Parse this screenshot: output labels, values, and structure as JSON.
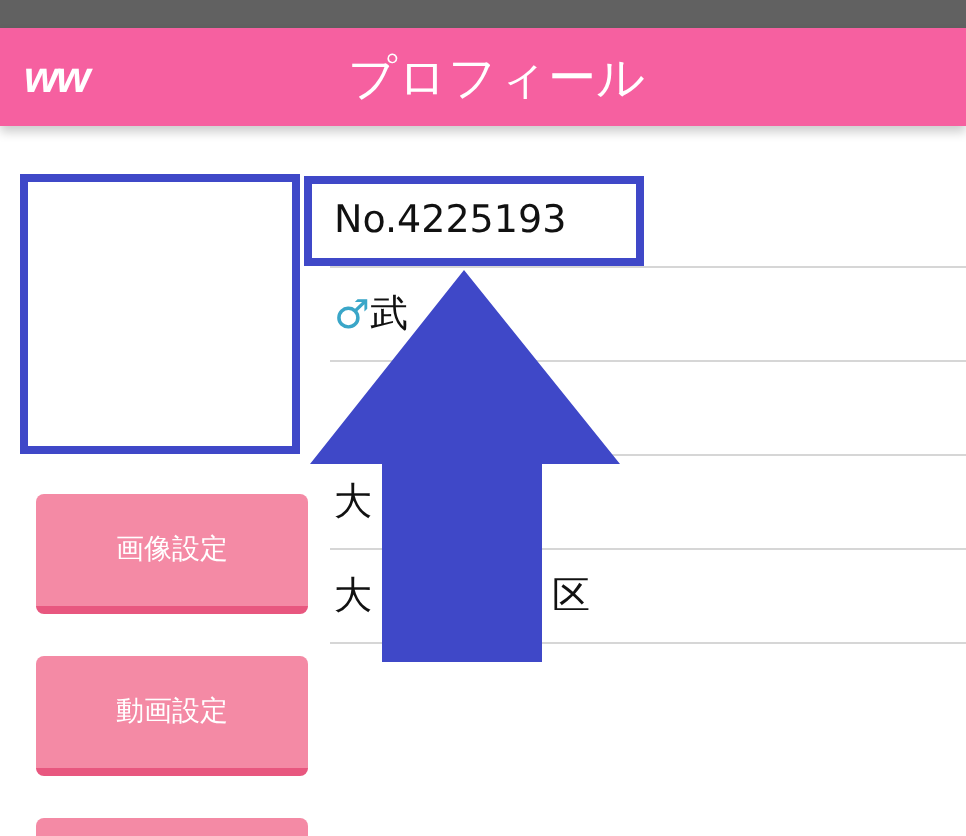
{
  "header": {
    "logo": "ww",
    "title": "プロフィール"
  },
  "avatar": {
    "highlighted": true
  },
  "buttons": [
    {
      "kind": "labeled",
      "label": "画像設定"
    },
    {
      "kind": "labeled",
      "label": "動画設定"
    },
    {
      "kind": "blank"
    }
  ],
  "rows": [
    {
      "texts": [
        "No.4225193"
      ],
      "highlighted": true
    },
    {
      "symbol": "♂",
      "texts": [
        "武"
      ],
      "highlighted": false
    },
    {
      "highlighted": false
    },
    {
      "texts": [
        "大"
      ],
      "highlighted": false
    },
    {
      "texts": [
        "大",
        "区"
      ],
      "highlighted": false
    }
  ]
}
